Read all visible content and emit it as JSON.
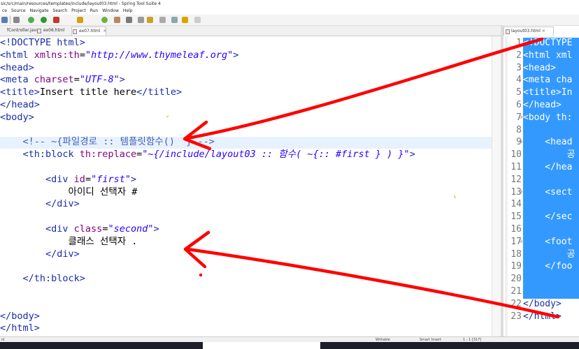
{
  "window": {
    "title": "sic/src/main/resources/templates/include/layout03.html - Spring Tool Suite 4"
  },
  "menu": [
    "ce",
    "Source",
    "Navigate",
    "Search",
    "Project",
    "Run",
    "Window",
    "Help"
  ],
  "tabs": [
    {
      "label": "fController.java",
      "active": false
    },
    {
      "label": "ex06.html",
      "active": false
    },
    {
      "label": "ex07.html",
      "active": true,
      "close": "✕"
    }
  ],
  "right_tab": {
    "label": "layout03.html",
    "close": "✕"
  },
  "editor": {
    "lines": [
      {
        "seg": [
          [
            "t-tag",
            "<!DOCTYPE html>"
          ]
        ]
      },
      {
        "seg": [
          [
            "t-tag",
            "<html "
          ],
          [
            "t-attr",
            "xmlns:th"
          ],
          [
            "t-txt",
            "="
          ],
          [
            "t-val",
            "\"http://www.thymeleaf.org\""
          ],
          [
            "t-tag",
            ">"
          ]
        ]
      },
      {
        "seg": [
          [
            "t-tag",
            "<head>"
          ]
        ]
      },
      {
        "seg": [
          [
            "t-tag",
            "<meta "
          ],
          [
            "t-attr",
            "charset"
          ],
          [
            "t-txt",
            "="
          ],
          [
            "t-val",
            "\"UTF-8\""
          ],
          [
            "t-tag",
            ">"
          ]
        ]
      },
      {
        "seg": [
          [
            "t-tag",
            "<title>"
          ],
          [
            "t-txt",
            "Insert title here"
          ],
          [
            "t-tag",
            "</title>"
          ]
        ]
      },
      {
        "seg": [
          [
            "t-tag",
            "</head>"
          ]
        ]
      },
      {
        "seg": [
          [
            "t-tag",
            "<body>"
          ]
        ]
      },
      {
        "seg": []
      },
      {
        "seg": [
          [
            "t-cmt",
            "    <!-- ~{파일경로 :: 템플릿함수()  } -->"
          ]
        ],
        "highlight": true
      },
      {
        "seg": [
          [
            "t-tag",
            "    <th:block "
          ],
          [
            "t-attr",
            "th:replace"
          ],
          [
            "t-txt",
            "="
          ],
          [
            "t-val",
            "\"~{/include/layout03 :: 함수( ~{:: #first } ) }\""
          ],
          [
            "t-tag",
            ">"
          ]
        ]
      },
      {
        "seg": []
      },
      {
        "seg": [
          [
            "t-tag",
            "        <div "
          ],
          [
            "t-attr",
            "id"
          ],
          [
            "t-txt",
            "="
          ],
          [
            "t-val",
            "\"first\""
          ],
          [
            "t-tag",
            ">"
          ]
        ]
      },
      {
        "seg": [
          [
            "t-txt",
            "            아이디 선택자 #"
          ]
        ]
      },
      {
        "seg": [
          [
            "t-tag",
            "        </div>"
          ]
        ]
      },
      {
        "seg": []
      },
      {
        "seg": [
          [
            "t-tag",
            "        <div "
          ],
          [
            "t-attr",
            "class"
          ],
          [
            "t-txt",
            "="
          ],
          [
            "t-val",
            "\"second\""
          ],
          [
            "t-tag",
            ">"
          ]
        ]
      },
      {
        "seg": [
          [
            "t-txt",
            "            클래스 선택자 ."
          ]
        ]
      },
      {
        "seg": [
          [
            "t-tag",
            "        </div>"
          ]
        ]
      },
      {
        "seg": []
      },
      {
        "seg": [
          [
            "t-tag",
            "    </th:block>"
          ]
        ]
      },
      {
        "seg": []
      },
      {
        "seg": []
      },
      {
        "seg": [
          [
            "t-tag",
            "</body>"
          ]
        ]
      },
      {
        "seg": [
          [
            "t-tag",
            "</html>"
          ]
        ]
      }
    ]
  },
  "right_editor": {
    "lines": [
      {
        "n": "1",
        "text": "<!DOCTYPE"
      },
      {
        "n": "2",
        "text": "<html xml"
      },
      {
        "n": "3",
        "text": "<head>"
      },
      {
        "n": "4",
        "text": "<meta cha"
      },
      {
        "n": "5",
        "text": "<title>In"
      },
      {
        "n": "6",
        "text": "</head>"
      },
      {
        "n": "7",
        "text": "<body th:",
        "fold": "⊖"
      },
      {
        "n": "8",
        "text": ""
      },
      {
        "n": "9",
        "text": "    <head",
        "fold": "⊖"
      },
      {
        "n": "10",
        "text": "        공"
      },
      {
        "n": "11",
        "text": "    </hea"
      },
      {
        "n": "12",
        "text": ""
      },
      {
        "n": "13",
        "text": "    <sect",
        "fold": "⊖"
      },
      {
        "n": "14",
        "text": ""
      },
      {
        "n": "15",
        "text": "    </sec"
      },
      {
        "n": "16",
        "text": ""
      },
      {
        "n": "17",
        "text": "    <foot",
        "fold": "⊖"
      },
      {
        "n": "18",
        "text": "        공"
      },
      {
        "n": "19",
        "text": "    </foo"
      },
      {
        "n": "20",
        "text": ""
      },
      {
        "n": "21",
        "text": ""
      },
      {
        "n": "22",
        "text": "</body>"
      },
      {
        "n": "23",
        "text": "</html>"
      }
    ]
  },
  "status": {
    "left": "nl",
    "writable": "Writable",
    "insert": "Smart Insert",
    "position": "1 : 1 [317]"
  },
  "colors": {
    "annotation": "#ff0000",
    "selection": "#3399ff",
    "current_line": "#e8f2fe"
  }
}
